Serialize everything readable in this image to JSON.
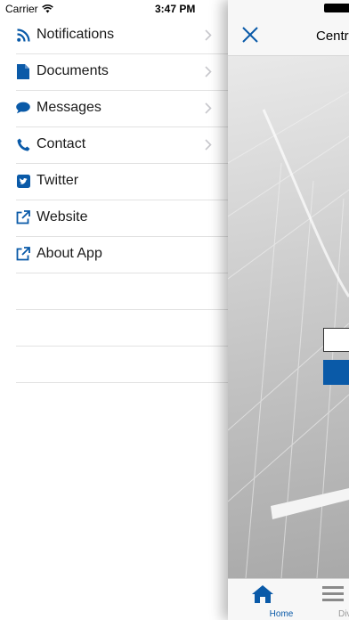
{
  "status_bar": {
    "carrier": "Carrier",
    "time": "3:47 PM"
  },
  "menu": {
    "items": [
      {
        "label": "Notifications",
        "icon": "rss-icon",
        "chevron": true
      },
      {
        "label": "Documents",
        "icon": "document-icon",
        "chevron": true
      },
      {
        "label": "Messages",
        "icon": "speech-bubble-icon",
        "chevron": true
      },
      {
        "label": "Contact",
        "icon": "phone-icon",
        "chevron": true
      },
      {
        "label": "Twitter",
        "icon": "twitter-icon",
        "chevron": false
      },
      {
        "label": "Website",
        "icon": "external-link-icon",
        "chevron": false
      },
      {
        "label": "About App",
        "icon": "external-link-icon",
        "chevron": false
      }
    ]
  },
  "main": {
    "title": "Centr",
    "tabs": [
      {
        "label": "Home",
        "icon": "home-icon",
        "active": true
      },
      {
        "label": "Divisions",
        "icon": "list-icon",
        "active": false
      }
    ]
  },
  "colors": {
    "accent": "#0a5aa8",
    "divider": "#e2e2e2"
  }
}
